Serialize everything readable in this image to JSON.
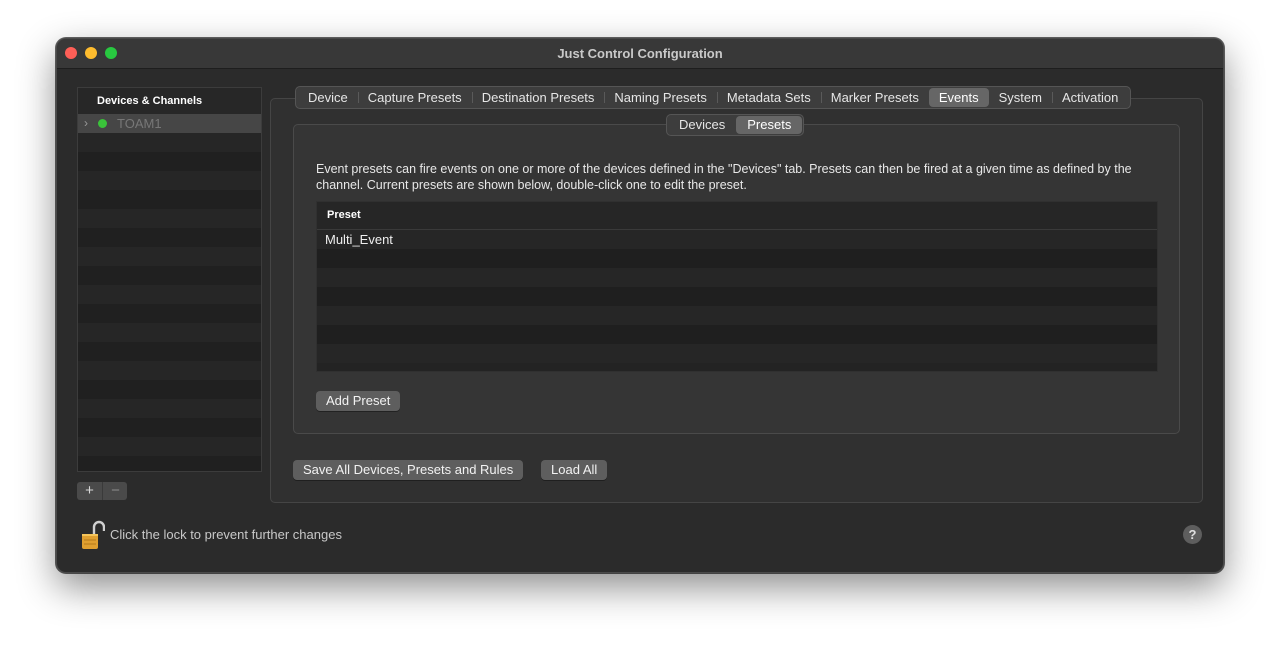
{
  "window": {
    "title": "Just Control Configuration"
  },
  "sidebar": {
    "header": "Devices & Channels",
    "items": [
      {
        "label": "TOAM1",
        "status_color": "#3ac23a",
        "expand_icon": "chevron-right-icon"
      }
    ],
    "add_label": "+",
    "remove_label": "−"
  },
  "tabs": [
    {
      "label": "Device",
      "active": false
    },
    {
      "label": "Capture Presets",
      "active": false
    },
    {
      "label": "Destination Presets",
      "active": false
    },
    {
      "label": "Naming Presets",
      "active": false
    },
    {
      "label": "Metadata Sets",
      "active": false
    },
    {
      "label": "Marker Presets",
      "active": false
    },
    {
      "label": "Events",
      "active": true
    },
    {
      "label": "System",
      "active": false
    },
    {
      "label": "Activation",
      "active": false
    }
  ],
  "segments": [
    {
      "label": "Devices",
      "active": false
    },
    {
      "label": "Presets",
      "active": true
    }
  ],
  "events": {
    "description": "Event presets can fire events on one or more of the devices defined in the \"Devices\" tab. Presets can then be fired at a given time as defined by the channel. Current presets are shown below, double-click one to edit the preset.",
    "table": {
      "column": "Preset",
      "rows": [
        "Multi_Event"
      ]
    },
    "add_preset_label": "Add Preset"
  },
  "footer": {
    "save_all_label": "Save All Devices, Presets and Rules",
    "load_all_label": "Load All",
    "lock_text": "Click the lock to prevent further changes",
    "lock_icon": "unlocked-padlock-icon",
    "help_label": "?"
  },
  "colors": {
    "window_bg": "#2b2b2b",
    "active_tab": "#666666",
    "status_green": "#3ac23a"
  }
}
